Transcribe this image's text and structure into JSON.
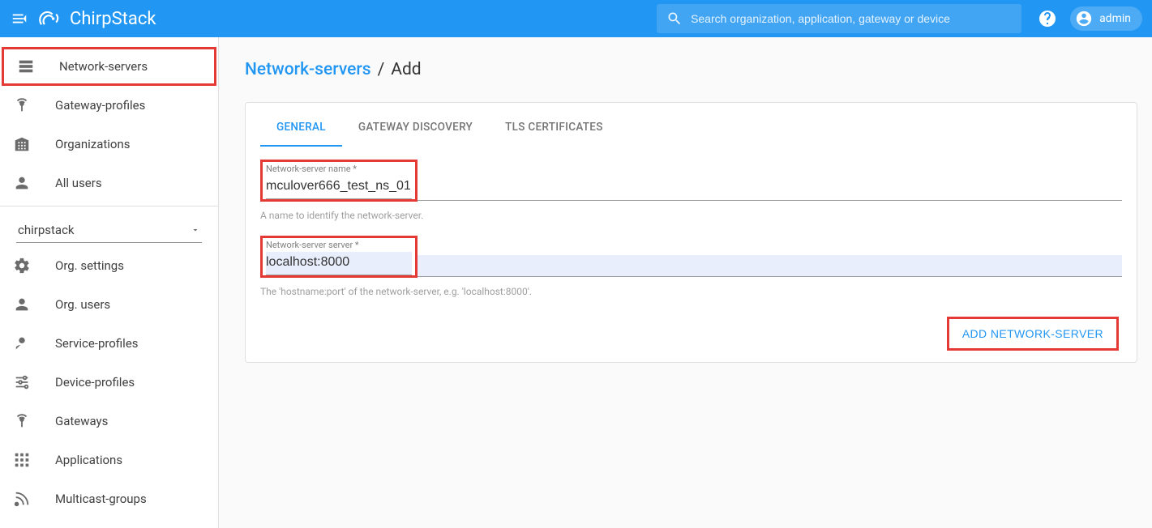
{
  "header": {
    "logo_text": "ChirpStack",
    "search_placeholder": "Search organization, application, gateway or device",
    "username": "admin"
  },
  "sidebar": {
    "items_top": [
      {
        "label": "Network-servers",
        "icon": "servers"
      },
      {
        "label": "Gateway-profiles",
        "icon": "antenna"
      },
      {
        "label": "Organizations",
        "icon": "building"
      },
      {
        "label": "All users",
        "icon": "person"
      }
    ],
    "org_select": "chirpstack",
    "items_bottom": [
      {
        "label": "Org. settings",
        "icon": "gear"
      },
      {
        "label": "Org. users",
        "icon": "person"
      },
      {
        "label": "Service-profiles",
        "icon": "service"
      },
      {
        "label": "Device-profiles",
        "icon": "sliders"
      },
      {
        "label": "Gateways",
        "icon": "antenna"
      },
      {
        "label": "Applications",
        "icon": "apps"
      },
      {
        "label": "Multicast-groups",
        "icon": "multicast"
      }
    ]
  },
  "breadcrumb": {
    "root": "Network-servers",
    "leaf": "Add"
  },
  "tabs": [
    {
      "label": "GENERAL",
      "active": true
    },
    {
      "label": "GATEWAY DISCOVERY",
      "active": false
    },
    {
      "label": "TLS CERTIFICATES",
      "active": false
    }
  ],
  "form": {
    "name_label": "Network-server name *",
    "name_value": "mculover666_test_ns_01",
    "name_help": "A name to identify the network-server.",
    "server_label": "Network-server server *",
    "server_value": "localhost:8000",
    "server_help": "The 'hostname:port' of the network-server, e.g. 'localhost:8000'.",
    "submit_label": "ADD NETWORK-SERVER"
  }
}
